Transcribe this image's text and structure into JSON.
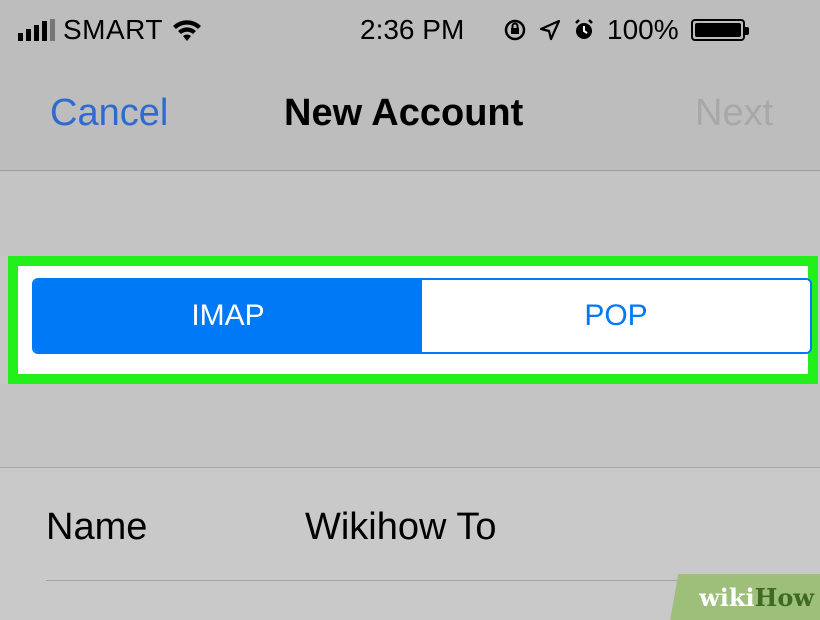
{
  "status_bar": {
    "carrier": "SMART",
    "time": "2:36 PM",
    "battery": "100%",
    "icons": [
      "signal-icon",
      "wifi-icon",
      "orientation-lock-icon",
      "location-icon",
      "alarm-icon",
      "battery-icon"
    ]
  },
  "nav": {
    "cancel_label": "Cancel",
    "title": "New Account",
    "next_label": "Next"
  },
  "segmented_control": {
    "options": [
      {
        "label": "IMAP",
        "selected": true
      },
      {
        "label": "POP",
        "selected": false
      }
    ],
    "highlight_color": "#23f01a",
    "accent_color": "#0079f7"
  },
  "form": {
    "name_label": "Name",
    "name_value": "Wikihow To"
  },
  "watermark": {
    "part1": "wiki",
    "part2": "How"
  }
}
